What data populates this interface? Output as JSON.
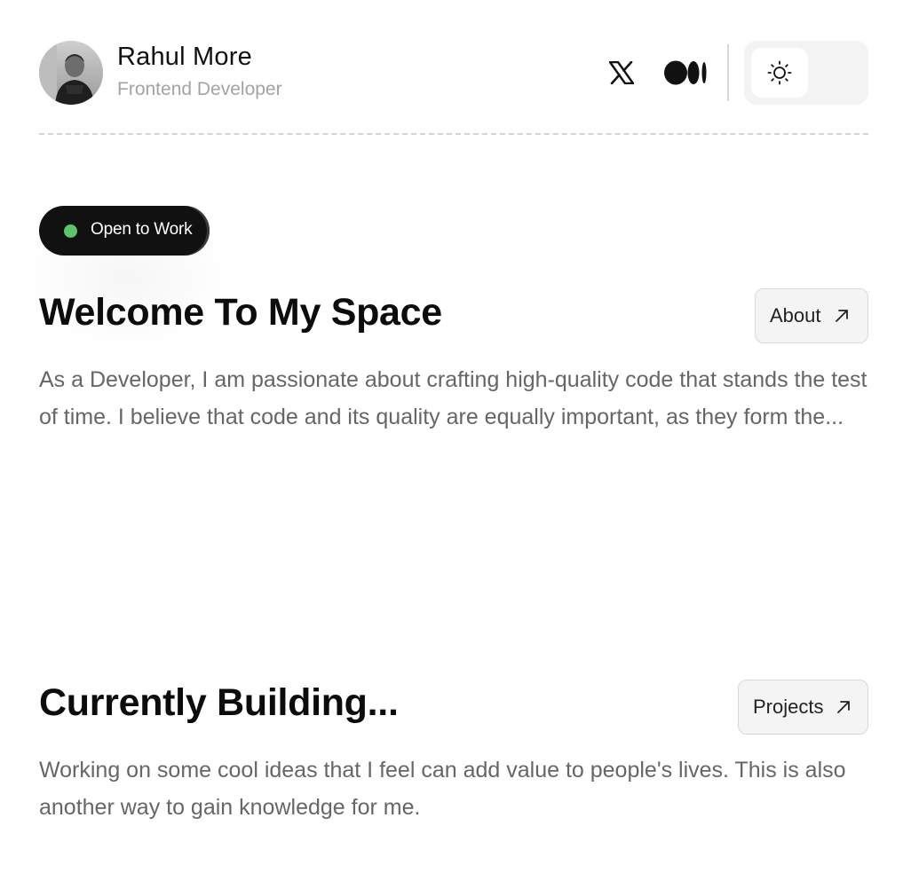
{
  "profile": {
    "name": "Rahul More",
    "role": "Frontend Developer"
  },
  "header": {
    "social": [
      {
        "icon": "x-logo-icon"
      },
      {
        "icon": "medium-logo-icon"
      }
    ],
    "theme_toggle": {
      "icon": "sun-icon",
      "mode": "light"
    }
  },
  "badge": {
    "label": "Open to Work",
    "status_color": "#5cc56b"
  },
  "welcome": {
    "title": "Welcome To My Space",
    "button_label": "About",
    "button_icon": "arrow-up-right-icon",
    "text": "As a Developer, I am passionate about crafting high-quality code that stands the test of time. I believe that code and its quality are equally important, as they form the..."
  },
  "building": {
    "title": "Currently Building...",
    "button_label": "Projects",
    "button_icon": "arrow-up-right-icon",
    "text": "Working on some cool ideas that I feel can add value to people's lives. This is also another way to gain knowledge for me."
  }
}
